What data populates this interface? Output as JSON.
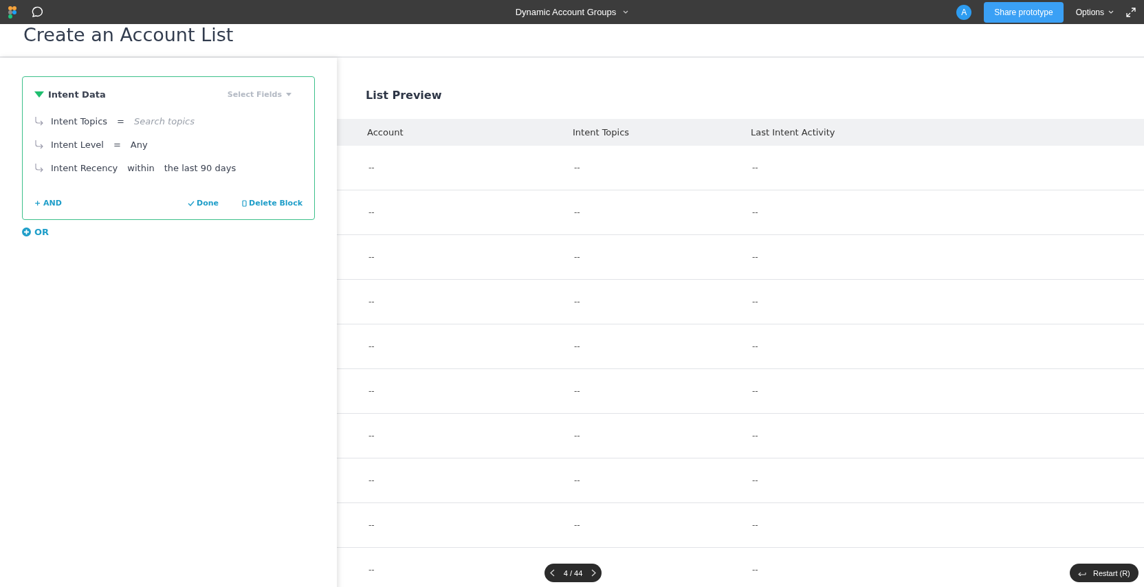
{
  "topbar": {
    "title": "Dynamic Account Groups",
    "avatar": "A",
    "share_button": "Share prototype",
    "options": "Options"
  },
  "page": {
    "title": "Create an Account List"
  },
  "filter_block": {
    "title": "Intent Data",
    "select_fields": "Select Fields",
    "conditions": [
      {
        "field": "Intent Topics",
        "operator": "=",
        "placeholder": "Search topics"
      },
      {
        "field": "Intent Level",
        "operator": "=",
        "value": "Any"
      },
      {
        "field": "Intent Recency",
        "operator": "within",
        "value": "the last 90 days"
      }
    ],
    "and_button": "+ AND",
    "done_button": "Done",
    "delete_button": "Delete Block"
  },
  "or_button": "OR",
  "preview": {
    "title": "List Preview",
    "columns": [
      "Account",
      "Intent Topics",
      "Last Intent Activity"
    ],
    "rows": [
      {
        "account": "--",
        "intent_topics": "--",
        "last_intent_activity": "--"
      },
      {
        "account": "--",
        "intent_topics": "--",
        "last_intent_activity": "--"
      },
      {
        "account": "--",
        "intent_topics": "--",
        "last_intent_activity": "--"
      },
      {
        "account": "--",
        "intent_topics": "--",
        "last_intent_activity": "--"
      },
      {
        "account": "--",
        "intent_topics": "--",
        "last_intent_activity": "--"
      },
      {
        "account": "--",
        "intent_topics": "--",
        "last_intent_activity": "--"
      },
      {
        "account": "--",
        "intent_topics": "--",
        "last_intent_activity": "--"
      },
      {
        "account": "--",
        "intent_topics": "--",
        "last_intent_activity": "--"
      },
      {
        "account": "--",
        "intent_topics": "--",
        "last_intent_activity": "--"
      },
      {
        "account": "--",
        "last_intent_activity": "--"
      }
    ]
  },
  "pager": {
    "text": "4 / 44"
  },
  "restart_button": "Restart (R)"
}
